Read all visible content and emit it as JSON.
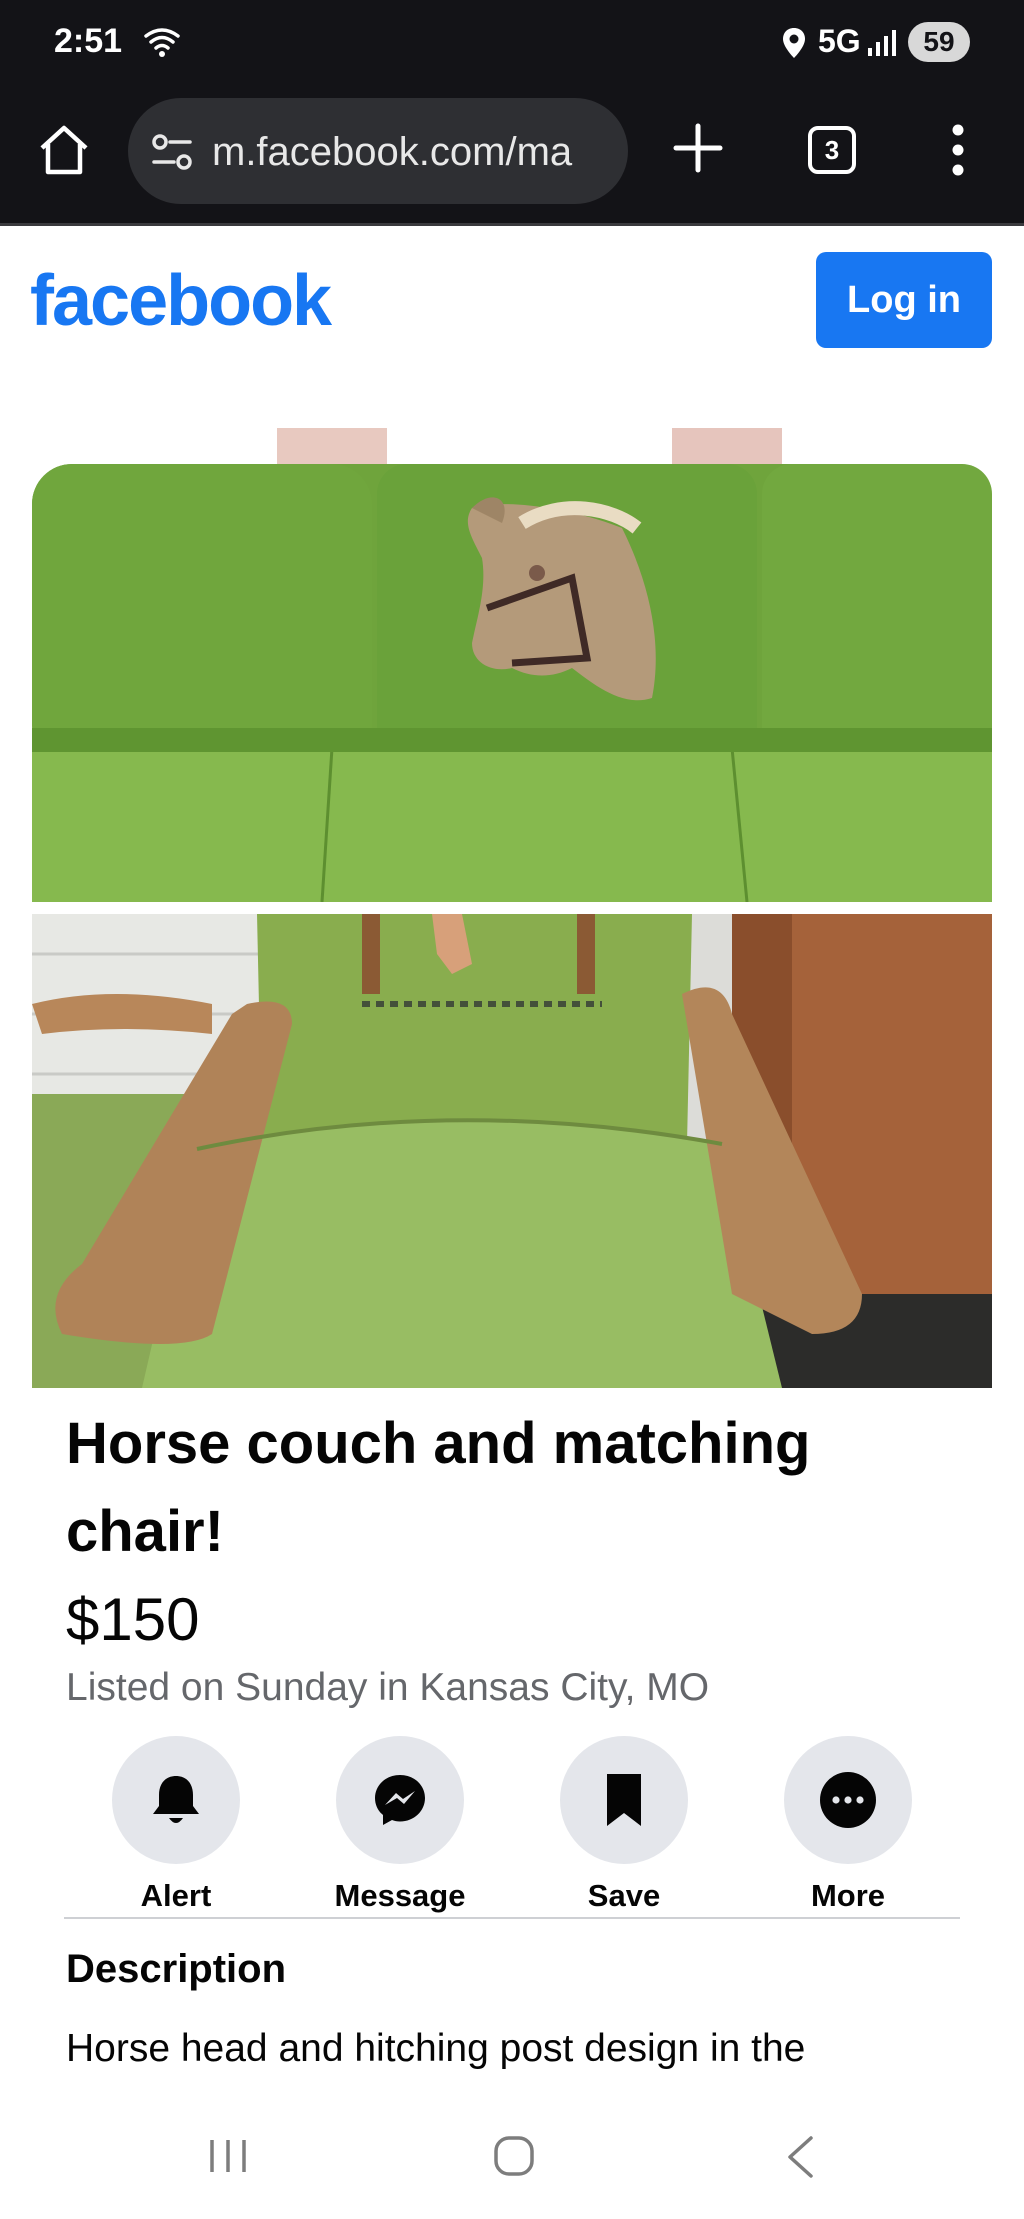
{
  "status_bar": {
    "time": "2:51",
    "network": "5G",
    "battery": "59"
  },
  "browser": {
    "url": "m.facebook.com/ma",
    "tab_count": "3"
  },
  "header": {
    "logo": "facebook",
    "login_label": "Log in",
    "brand_color": "#1877f2"
  },
  "listing": {
    "title": "Horse couch and matching chair!",
    "price": "$150",
    "meta": "Listed on Sunday in Kansas City, MO",
    "photos": [
      {
        "name": "green-couch-with-horse-head-design"
      },
      {
        "name": "green-chair-with-wooden-arms"
      }
    ]
  },
  "actions": [
    {
      "label": "Alert",
      "icon": "bell-icon"
    },
    {
      "label": "Message",
      "icon": "messenger-icon"
    },
    {
      "label": "Save",
      "icon": "bookmark-icon"
    },
    {
      "label": "More",
      "icon": "more-dots-icon"
    }
  ],
  "description": {
    "heading": "Description",
    "text": "Horse head and hitching post design in the"
  }
}
